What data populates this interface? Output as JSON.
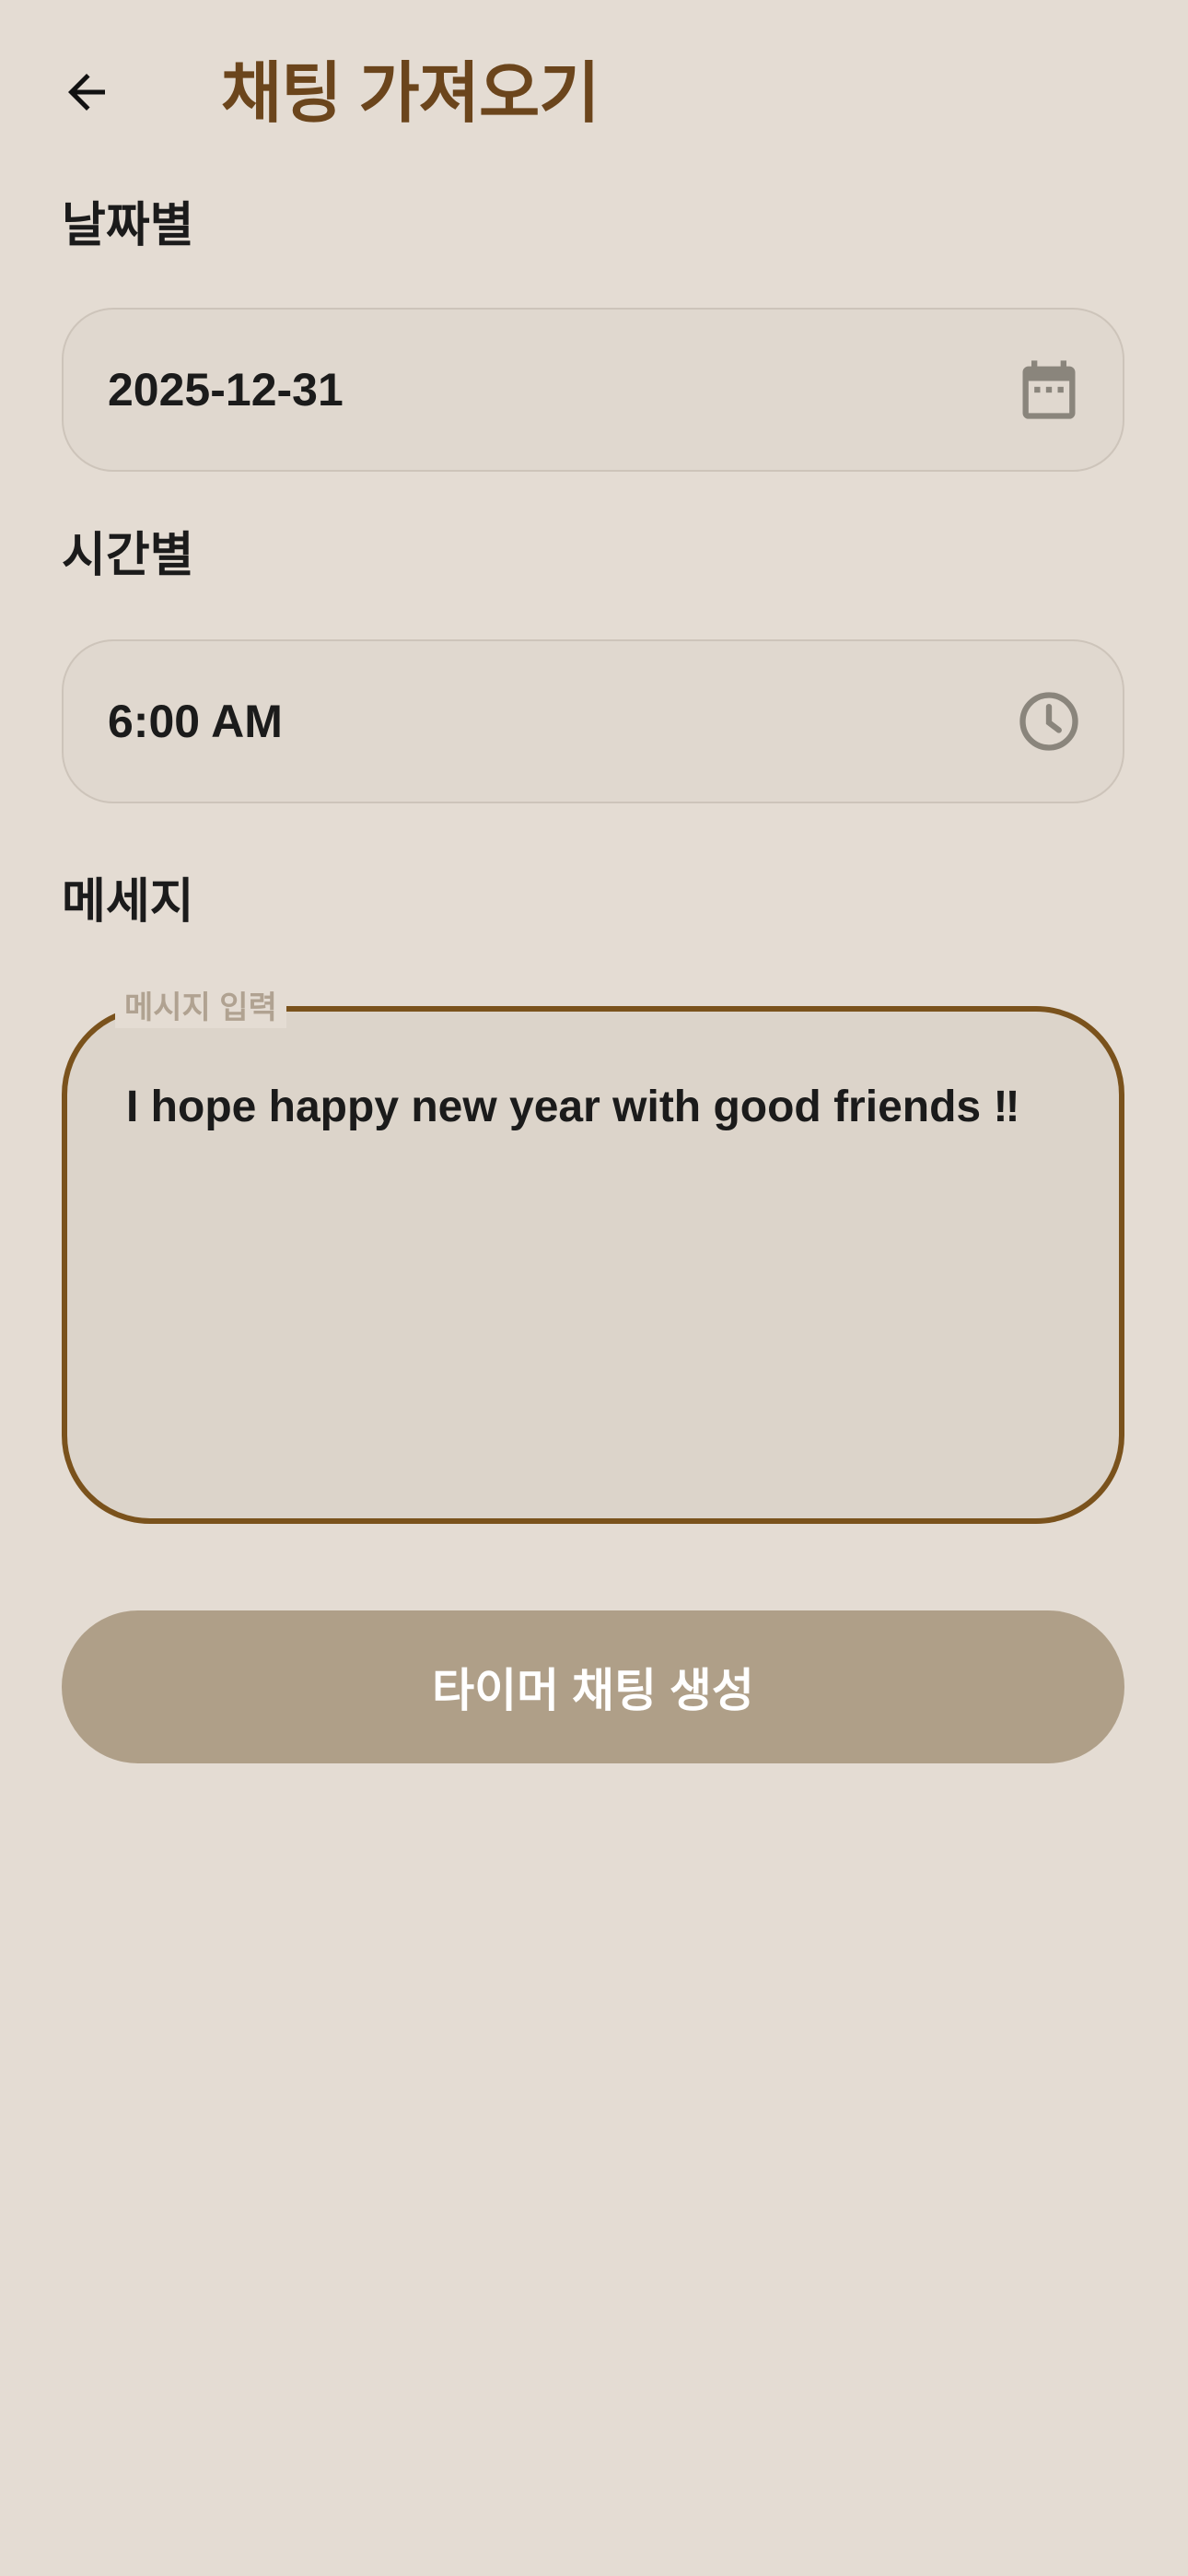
{
  "header": {
    "back_icon": "arrow-left-icon",
    "title": "채팅 가져오기"
  },
  "date_section": {
    "label": "날짜별",
    "value": "2025-12-31",
    "icon": "calendar-icon"
  },
  "time_section": {
    "label": "시간별",
    "value": "6:00 AM",
    "icon": "clock-icon"
  },
  "message_section": {
    "label": "메세지",
    "field_label": "메시지 입력",
    "value": "I hope happy new year with good friends ‼"
  },
  "submit": {
    "label": "타이머 채팅 생성"
  },
  "colors": {
    "background": "#e4dcd3",
    "title": "#6b451c",
    "focused_border": "#7a521c",
    "button": "#af9f88",
    "icon": "#8a857c"
  }
}
